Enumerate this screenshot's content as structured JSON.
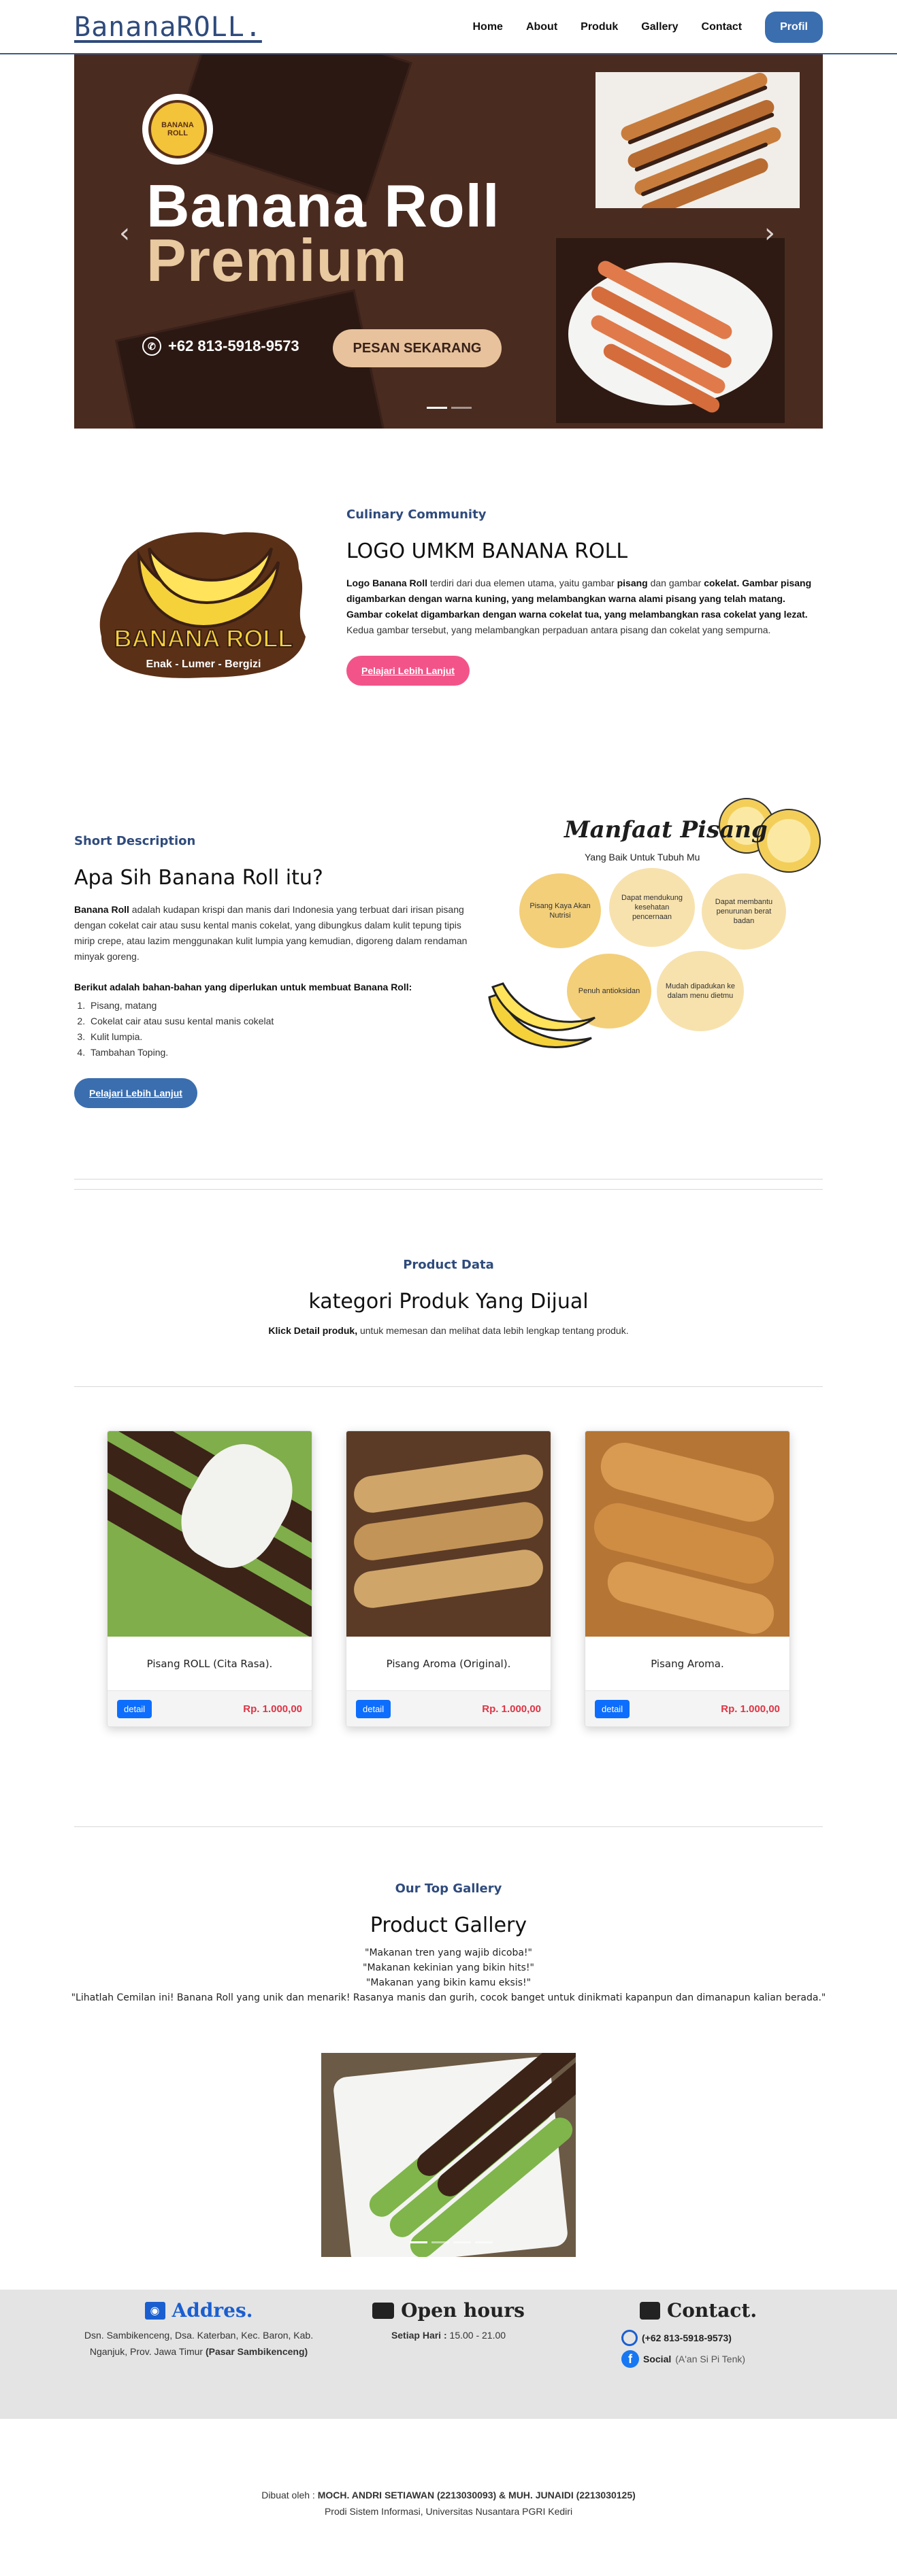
{
  "navbar": {
    "brand": "BananaROLL.",
    "links": [
      "Home",
      "About",
      "Produk",
      "Gallery",
      "Contact"
    ],
    "profile_button": "Profil"
  },
  "hero": {
    "badge_text": "BANANA ROLL",
    "title_line1": "Banana Roll",
    "title_line2": "Premium",
    "phone": "+62 813-5918-9573",
    "cta": "PESAN SEKARANG",
    "prev_icon": "chevron-left-icon",
    "next_icon": "chevron-right-icon",
    "active_slide": 1,
    "total_slides": 2
  },
  "logo_section": {
    "kicker": "Culinary Community",
    "title": "LOGO UMKM BANANA ROLL",
    "paragraph_parts": {
      "p1": "Logo Banana Roll",
      "p2": " terdiri dari dua elemen utama, yaitu gambar ",
      "p3": "pisang",
      "p4": " dan gambar ",
      "p5": "cokelat. Gambar pisang digambarkan dengan warna kuning, yang melambangkan warna alami pisang yang telah matang. Gambar cokelat digambarkan dengan warna cokelat tua, yang melambangkan rasa cokelat yang lezat.",
      "p6": " Kedua gambar tersebut, yang melambangkan perpaduan antara pisang dan cokelat yang sempurna."
    },
    "button": "Pelajari Lebih Lanjut",
    "logo_words": {
      "main": "BANANA ROLL",
      "tagline": "Enak - Lumer - Bergizi"
    }
  },
  "desc_section": {
    "kicker": "Short Description",
    "title": "Apa Sih Banana Roll itu?",
    "para_bold": "Banana Roll",
    "para_rest": " adalah kudapan krispi dan manis dari Indonesia yang terbuat dari irisan pisang dengan cokelat cair atau susu kental manis cokelat, yang dibungkus dalam kulit tepung tipis mirip crepe, atau lazim menggunakan kulit lumpia yang kemudian, digoreng dalam rendaman minyak goreng.",
    "ingredients_title": "Berikut adalah bahan-bahan yang diperlukan untuk membuat Banana Roll:",
    "ingredients": [
      "Pisang, matang",
      "Cokelat cair atau susu kental manis cokelat",
      "Kulit lumpia.",
      "Tambahan Toping."
    ],
    "button": "Pelajari Lebih Lanjut",
    "benefit": {
      "title": "Manfaat Pisang",
      "subtitle": "Yang Baik Untuk Tubuh Mu",
      "items": [
        "Pisang Kaya Akan Nutrisi",
        "Dapat mendukung kesehatan pencernaan",
        "Dapat membantu penurunan berat badan",
        "Penuh antioksidan",
        "Mudah dipadukan ke dalam menu dietmu"
      ]
    }
  },
  "product_section": {
    "kicker": "Product Data",
    "title": "kategori Produk Yang Dijual",
    "note_bold": "Klick Detail produk,",
    "note_rest": " untuk memesan dan melihat data lebih lengkap tentang produk.",
    "products": [
      {
        "name": "Pisang ROLL (Cita Rasa).",
        "button": "detail",
        "price": "Rp. 1.000,00"
      },
      {
        "name": "Pisang Aroma (Original).",
        "button": "detail",
        "price": "Rp. 1.000,00"
      },
      {
        "name": "Pisang Aroma.",
        "button": "detail",
        "price": "Rp. 1.000,00"
      }
    ]
  },
  "gallery_section": {
    "kicker": "Our Top Gallery",
    "title": "Product Gallery",
    "quotes": [
      "\"Makanan tren yang wajib dicoba!\"",
      "\"Makanan kekinian yang bikin hits!\"",
      "\"Makanan yang bikin kamu eksis!\"",
      "\"Lihatlah Cemilan ini! Banana Roll yang unik dan menarik! Rasanya manis dan gurih, cocok banget untuk dinikmati kapanpun dan dimanapun kalian berada.\""
    ]
  },
  "info_section": {
    "address_title": "Addres.",
    "address_line1": "Dsn. Sambikenceng, Dsa. Katerban, Kec. Baron, Kab.",
    "address_line2": "Nganjuk, Prov. Jawa Timur ",
    "address_bold": "(Pasar Sambikenceng)",
    "hours_title": "Open hours",
    "hours_label": "Setiap Hari :",
    "hours_value": " 15.00 - 21.00",
    "contact_title": "Contact.",
    "whatsapp": "(+62 813-5918-9573)",
    "social_label": "Social",
    "social_value": " (A'an Si Pi Tenk)",
    "colors": {
      "address_icon": "#1a5fd0",
      "whatsapp": "#1a5fd0",
      "facebook": "#1877f2"
    }
  },
  "footer": {
    "made_by_prefix": "Dibuat oleh : ",
    "made_by_names": "MOCH. ANDRI SETIAWAN (2213030093) & MUH. JUNAIDI (2213030125)",
    "institution": "Prodi Sistem Informasi, Universitas Nusantara PGRI Kediri"
  }
}
